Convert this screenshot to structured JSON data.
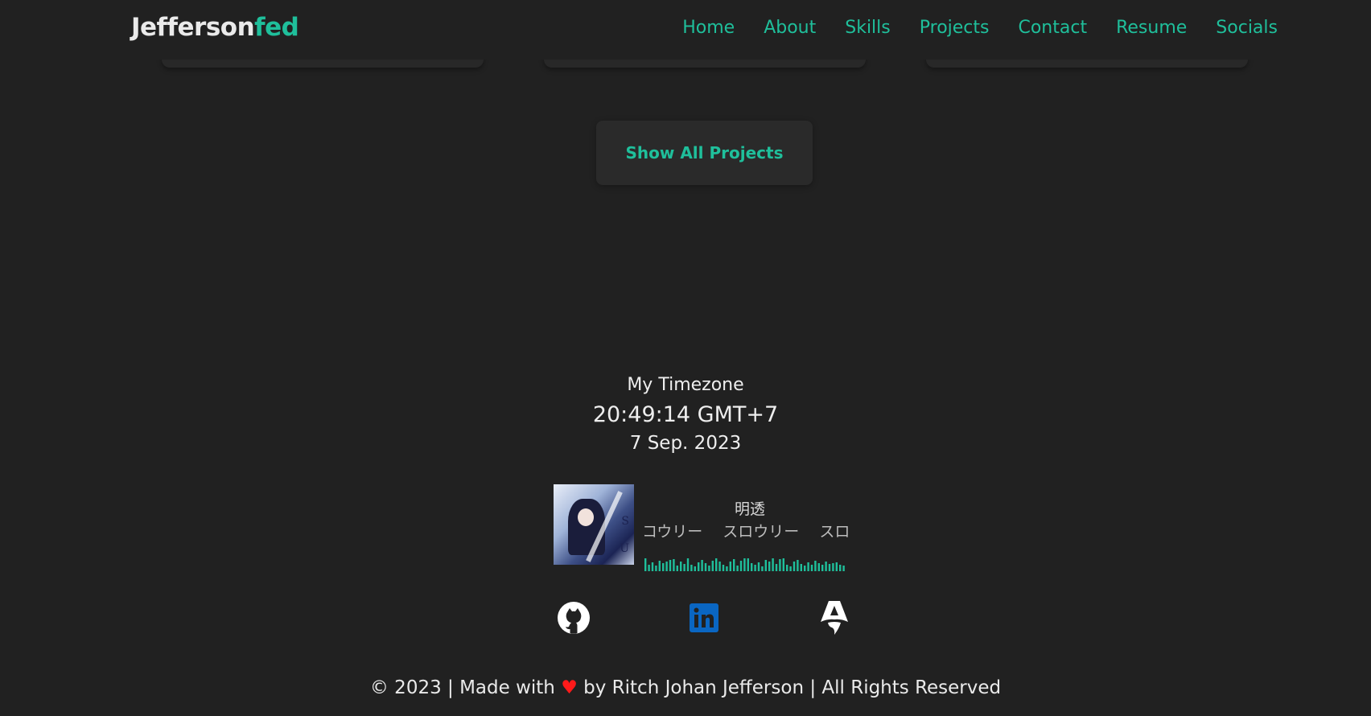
{
  "nav": {
    "brand_main": "Jefferson",
    "brand_accent": "fed",
    "links": [
      "Home",
      "About",
      "Skills",
      "Projects",
      "Contact",
      "Resume",
      "Socials"
    ]
  },
  "projects": {
    "show_all_label": "Show All Projects"
  },
  "timezone": {
    "title": "My Timezone",
    "time": "20:49:14 GMT+7",
    "date": "7 Sep. 2023"
  },
  "now_playing": {
    "title": "明透",
    "artist_scroll": "コウリー　 スロウリー　 スロ",
    "album_art_letters": [
      "S",
      "U"
    ]
  },
  "socials": {
    "icons": [
      "github-icon",
      "linkedin-icon",
      "astro-icon"
    ]
  },
  "footer": {
    "text_before": "© 2023 | Made with ",
    "heart": "♥",
    "text_after": " by Ritch Johan Jefferson | All Rights Reserved"
  },
  "colors": {
    "background": "#212121",
    "accent": "#1fbf9b",
    "linkedin": "#0a66c2",
    "heart": "#ff1a1a"
  }
}
